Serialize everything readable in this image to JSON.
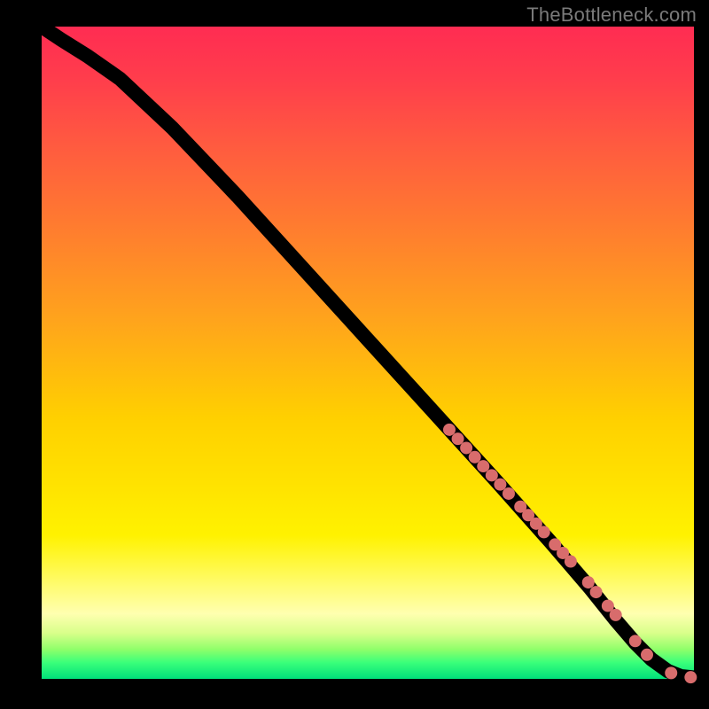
{
  "watermark": "TheBottleneck.com",
  "colors": {
    "background": "#000000",
    "curve": "#000000",
    "marker": "#d86c6c"
  },
  "chart_data": {
    "type": "line",
    "title": "",
    "xlabel": "",
    "ylabel": "",
    "xlim": [
      0,
      100
    ],
    "ylim": [
      0,
      100
    ],
    "grid": false,
    "legend": false,
    "series": [
      {
        "name": "curve",
        "x": [
          0,
          3,
          7,
          12,
          20,
          30,
          40,
          50,
          60,
          70,
          78,
          84,
          88,
          91,
          93.5,
          96,
          98,
          100
        ],
        "y": [
          100,
          98,
          95.5,
          92,
          84.5,
          74,
          63,
          52,
          41,
          30,
          21,
          14,
          9,
          5.5,
          3,
          1.2,
          0.4,
          0.2
        ]
      }
    ],
    "markers": {
      "name": "points",
      "x": [
        62.5,
        63.8,
        65.1,
        66.4,
        67.7,
        69.0,
        70.3,
        71.6,
        73.4,
        74.6,
        75.8,
        77.0,
        78.7,
        79.9,
        81.1,
        83.8,
        85.0,
        86.8,
        88.0,
        91.0,
        92.8,
        96.5,
        99.5
      ],
      "y": [
        38.2,
        36.8,
        35.4,
        34.0,
        32.6,
        31.2,
        29.8,
        28.4,
        26.4,
        25.1,
        23.8,
        22.5,
        20.6,
        19.3,
        18.0,
        14.8,
        13.3,
        11.2,
        9.8,
        5.8,
        3.7,
        0.9,
        0.25
      ]
    }
  }
}
